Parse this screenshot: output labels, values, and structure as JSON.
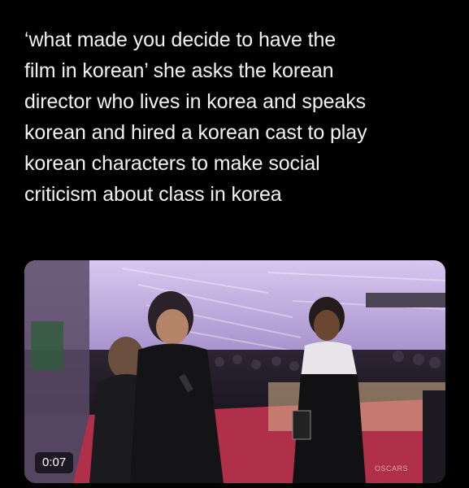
{
  "post": {
    "text": "‘what made you decide to have the\nfilm in korean’ she asks the korean\ndirector who lives in korea and speaks\nkorean and hired a korean cast to play\nkorean characters to make social\ncriticism about class in korea"
  },
  "video": {
    "duration": "0:07",
    "watermark": "OSCARS"
  },
  "colors": {
    "background": "#000000",
    "carpet": "#b0304a",
    "tent": "#cdb8e8"
  }
}
